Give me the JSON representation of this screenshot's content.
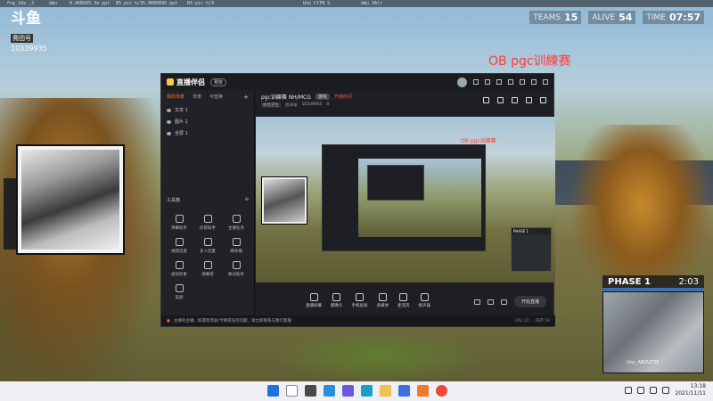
{
  "topbar": {
    "items": [
      "Fng_10a ,3",
      "dmu",
      "0.0KBX95.3a ppt",
      "R5 pic h/3",
      "5.0KB9095 ppt",
      "R5 pic h/3",
      "Uno CtTN S",
      "dmu 3Alr"
    ]
  },
  "logo": {
    "main": "斗鱼",
    "sub": "斋团号",
    "id": "10339935"
  },
  "stats": [
    {
      "key": "TEAMS",
      "value": "15"
    },
    {
      "key": "ALIVE",
      "value": "54"
    },
    {
      "key": "TIME",
      "value": "07:57"
    }
  ],
  "ob_title": "OB pgc训練赛",
  "app": {
    "brand": "直播伴侣",
    "version": "预览",
    "left_tabs": [
      "我的场景",
      "背景",
      "可替换"
    ],
    "layers": [
      "文本 1",
      "图片 1",
      "全屏 1"
    ],
    "tools_title": "工具箱",
    "tools": [
      "弹幕助手",
      "房管助手",
      "主播任务",
      "视频连麦",
      "多人连麦",
      "媒体播",
      "虚拟形象",
      "弹幕卷",
      "歌词助手",
      "美颜"
    ],
    "room": {
      "title": "pgc训練赛 NH/MCG",
      "tag": "游戏",
      "red_note": "开播时间",
      "category": "绝地求生",
      "room_id_label": "房间号",
      "room_id": "10339935",
      "hot": "0"
    },
    "preview_title": "OB pgc训練赛",
    "bottom_tools": [
      "直播屏幕",
      "摄像头",
      "手机投屏",
      "多媒体",
      "麦克风",
      "扬声器"
    ],
    "start_button": "开始直播",
    "status_warn": "主要的主播，如遇到黑屏/卡顿或任何问题，请立即联系与我们客服",
    "status_right": "CPU 22 ... 内存 59"
  },
  "phase": {
    "label": "PHASE 1",
    "time": "2:03",
    "player": "Uno_ABOUZ3E"
  },
  "clock": {
    "time": "13:18",
    "date": "2021/11/11"
  },
  "taskbar": {
    "icons": [
      "windows-icon",
      "search-icon",
      "taskview-icon",
      "widgets-icon",
      "chat-icon",
      "edge-icon",
      "explorer-icon",
      "store-icon",
      "app-icon",
      "chrome-icon"
    ]
  }
}
